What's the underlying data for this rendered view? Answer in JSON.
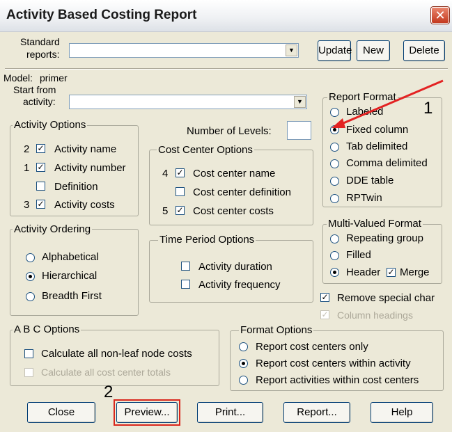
{
  "window": {
    "title": "Activity Based Costing Report",
    "close_glyph": "✕"
  },
  "top": {
    "standard_reports_label_1": "Standard",
    "standard_reports_label_2": "reports:",
    "update_label": "Update",
    "new_label": "New",
    "delete_label": "Delete"
  },
  "model": {
    "label": "Model:",
    "value": "primer"
  },
  "start": {
    "label_1": "Start from",
    "label_2": "activity:"
  },
  "num_levels_label": "Number of Levels:",
  "activity_options": {
    "title": "Activity Options",
    "items": [
      {
        "num": "2",
        "label": "Activity name",
        "checked": true
      },
      {
        "num": "1",
        "label": "Activity number",
        "checked": true
      },
      {
        "num": "",
        "label": "Definition",
        "checked": false
      },
      {
        "num": "3",
        "label": "Activity costs",
        "checked": true
      }
    ]
  },
  "cost_center_options": {
    "title": "Cost Center Options",
    "items": [
      {
        "num": "4",
        "label": "Cost center name",
        "checked": true
      },
      {
        "num": "",
        "label": "Cost center definition",
        "checked": false
      },
      {
        "num": "5",
        "label": "Cost center costs",
        "checked": true
      }
    ]
  },
  "report_format": {
    "title": "Report Format",
    "items": [
      "Labeled",
      "Fixed column",
      "Tab delimited",
      "Comma delimited",
      "DDE table",
      "RPTwin"
    ],
    "selected": "Fixed column"
  },
  "multi_valued": {
    "title": "Multi-Valued Format",
    "items": [
      "Repeating group",
      "Filled",
      "Header"
    ],
    "selected": "Header",
    "merge_label": "Merge",
    "merge_checked": true
  },
  "activity_ordering": {
    "title": "Activity Ordering",
    "items": [
      "Alphabetical",
      "Hierarchical",
      "Breadth First"
    ],
    "selected": "Hierarchical"
  },
  "time_period": {
    "title": "Time Period Options",
    "items": [
      "Activity duration",
      "Activity frequency"
    ]
  },
  "remove_special_char": {
    "label": "Remove special char",
    "checked": true
  },
  "column_headings": {
    "label": "Column headings",
    "checked": true
  },
  "abc_options": {
    "title": "A B C  Options",
    "items": [
      "Calculate all non-leaf node costs",
      "Calculate all cost center totals"
    ]
  },
  "format_options": {
    "title": "Format Options",
    "items": [
      "Report cost centers only",
      "Report cost centers within activity",
      "Report activities within cost centers"
    ],
    "selected": "Report cost centers within activity"
  },
  "buttons": {
    "close": "Close",
    "preview": "Preview...",
    "print": "Print...",
    "report": "Report...",
    "help": "Help"
  },
  "annotations": {
    "one": "1",
    "two": "2"
  },
  "colors": {
    "annotation_red": "#e32222",
    "preview_highlight": "#d9261c"
  }
}
